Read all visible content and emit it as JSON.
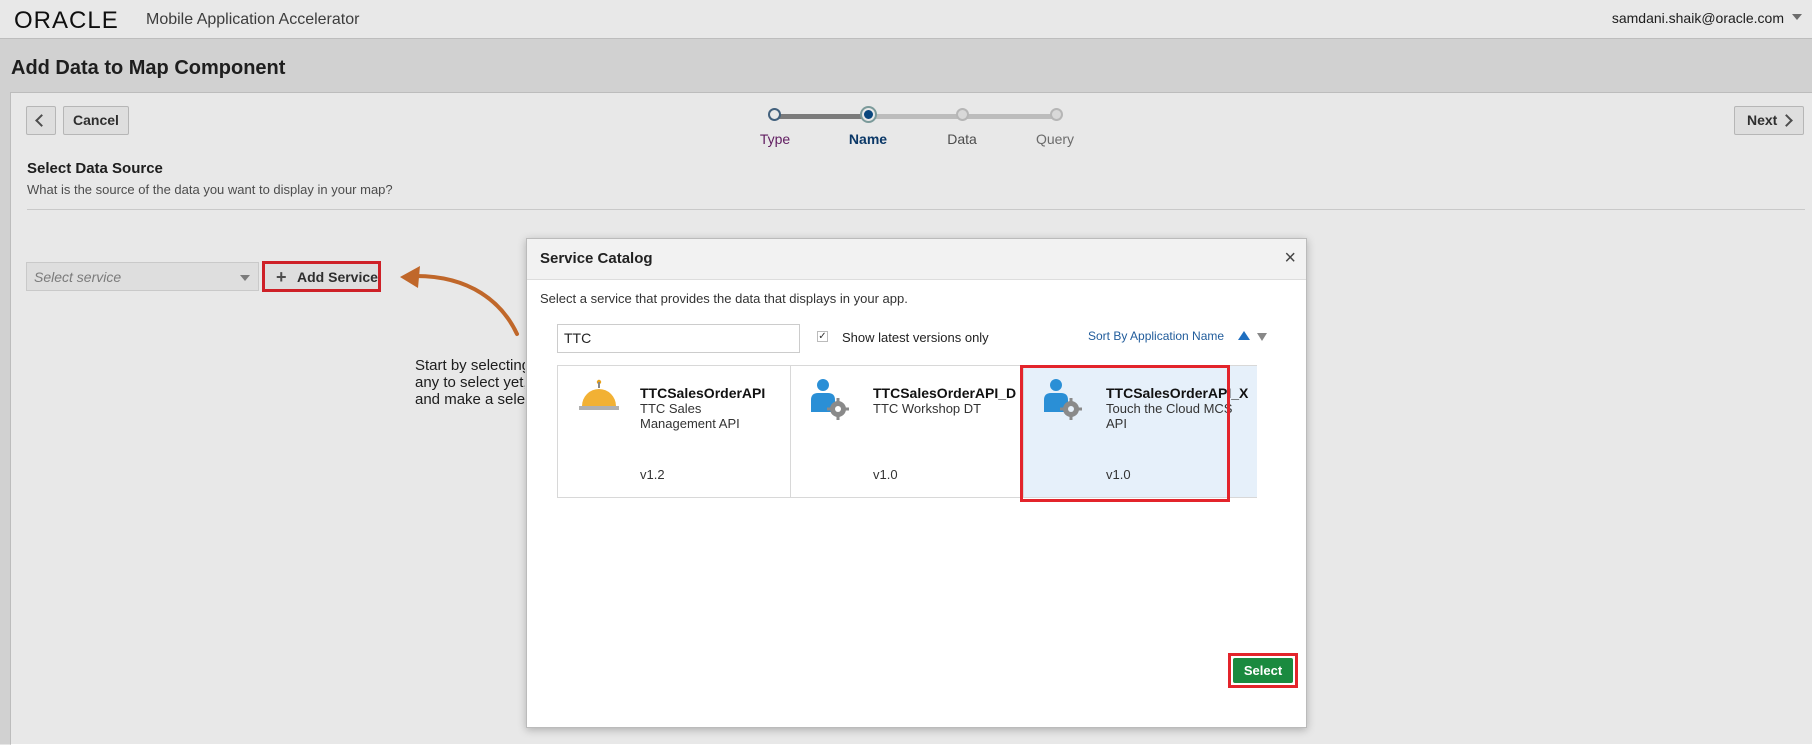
{
  "header": {
    "logo": "ORACLE",
    "app_name": "Mobile Application Accelerator",
    "user": "samdani.shaik@oracle.com"
  },
  "page": {
    "title": "Add Data to Map Component",
    "cancel_label": "Cancel",
    "next_label": "Next",
    "train": [
      {
        "label": "Type",
        "state": "visited"
      },
      {
        "label": "Name",
        "state": "current"
      },
      {
        "label": "Data",
        "state": "upcoming"
      },
      {
        "label": "Query",
        "state": "upcoming"
      }
    ],
    "section_title": "Select Data Source",
    "section_subtitle": "What is the source of the data you want to display in your map?",
    "select_service_placeholder": "Select service",
    "add_service_label": "Add Service",
    "help_text": [
      "Start by selecting",
      "any to select yet,",
      "and make a selec"
    ]
  },
  "dialog": {
    "title": "Service Catalog",
    "close": "×",
    "instruction": "Select a service that provides the data that displays in your app.",
    "search_value": "TTC",
    "show_latest_label": "Show latest versions only",
    "show_latest_checked": true,
    "sort_label": "Sort By Application Name",
    "select_label": "Select",
    "services": [
      {
        "name": "TTCSalesOrderAPI",
        "description": "TTC Sales Management API",
        "version": "v1.2",
        "icon": "service-bell-icon"
      },
      {
        "name": "TTCSalesOrderAPI_D",
        "description": "TTC Workshop DT",
        "version": "v1.0",
        "icon": "user-gear-icon"
      },
      {
        "name": "TTCSalesOrderAPI_X",
        "description": "Touch the Cloud MCS API",
        "version": "v1.0",
        "icon": "user-gear-icon",
        "selected": true
      }
    ]
  },
  "colors": {
    "highlight_red": "#e3242b",
    "select_green": "#1a8a3f",
    "selected_card": "#e6f0fa",
    "arrow": "#c0672a"
  }
}
